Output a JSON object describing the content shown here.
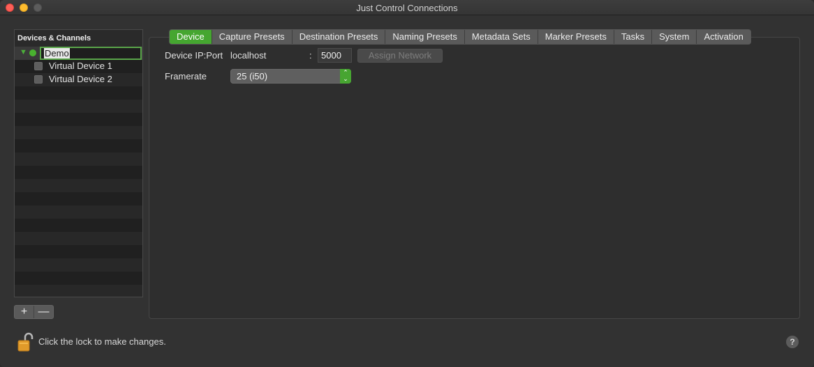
{
  "window": {
    "title": "Just Control Connections"
  },
  "sidebar": {
    "header": "Devices & Channels",
    "device": {
      "name": "Demo",
      "status_color": "#49b22f"
    },
    "channels": [
      {
        "label": "Virtual Device 1"
      },
      {
        "label": "Virtual Device 2"
      }
    ],
    "add_label": "+",
    "remove_label": "—"
  },
  "tabs": [
    {
      "label": "Device",
      "active": true
    },
    {
      "label": "Capture Presets"
    },
    {
      "label": "Destination Presets"
    },
    {
      "label": "Naming Presets"
    },
    {
      "label": "Metadata Sets"
    },
    {
      "label": "Marker Presets"
    },
    {
      "label": "Tasks"
    },
    {
      "label": "System"
    },
    {
      "label": "Activation"
    }
  ],
  "device_tab": {
    "ip_port_label": "Device IP:Port",
    "ip_value": "localhost",
    "port_separator": ":",
    "port_value": "5000",
    "assign_network_label": "Assign Network",
    "framerate_label": "Framerate",
    "framerate_value": "25 (i50)"
  },
  "footer": {
    "lock_text": "Click the lock to make changes.",
    "help_label": "?"
  },
  "colors": {
    "accent": "#45a630"
  }
}
